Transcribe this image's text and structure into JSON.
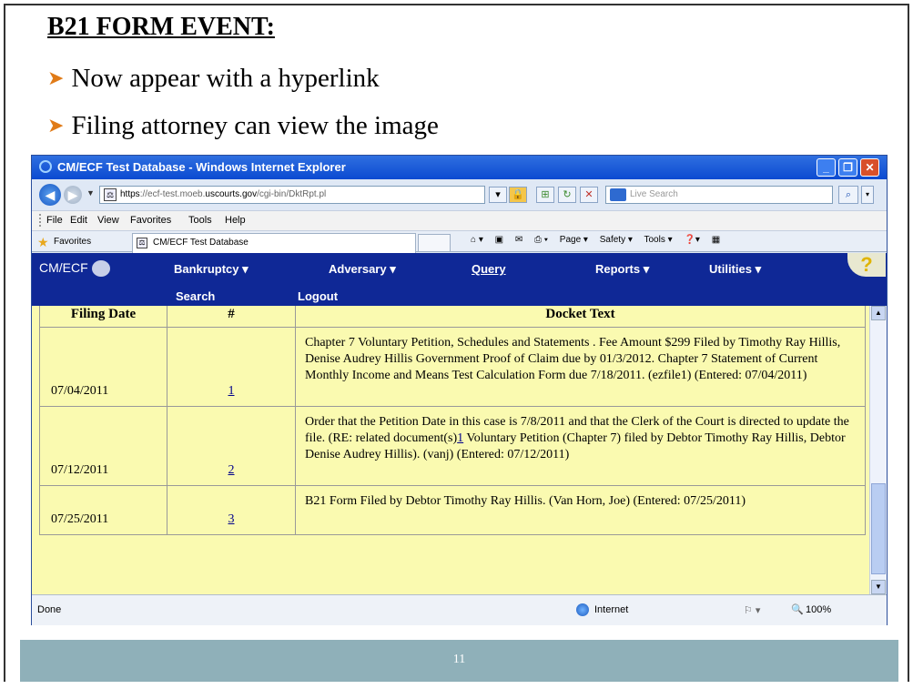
{
  "slide": {
    "title": "B21 FORM EVENT:",
    "bullets": [
      "Now appear with a hyperlink",
      "Filing attorney can view the image"
    ],
    "page_number": "11"
  },
  "browser": {
    "window_title": "CM/ECF Test Database - Windows Internet Explorer",
    "address": {
      "scheme": "https",
      "pre_host": "://ecf-test.moeb.",
      "host": "uscourts.gov",
      "path": "/cgi-bin/DktRpt.pl"
    },
    "search_placeholder": "Live Search",
    "menu": [
      "File",
      "Edit",
      "View",
      "Favorites",
      "Tools",
      "Help"
    ],
    "favorites_label": "Favorites",
    "tab_label": "CM/ECF Test Database",
    "command_bar": [
      "Page ▾",
      "Safety ▾",
      "Tools ▾"
    ],
    "status_text": "Done",
    "zone": "Internet",
    "zoom": "100%"
  },
  "ecf": {
    "logo_text": "CM/ECF",
    "nav": [
      "Bankruptcy ▾",
      "Adversary ▾",
      "Query",
      "Reports ▾",
      "Utilities ▾"
    ],
    "nav_row2": [
      "Search",
      "Logout"
    ],
    "help": "?"
  },
  "docket": {
    "headers": [
      "Filing Date",
      "#",
      "Docket Text"
    ],
    "rows": [
      {
        "date": "07/04/2011",
        "num": "1",
        "text": "Chapter 7 Voluntary Petition, Schedules and Statements . Fee Amount $299 Filed by Timothy Ray Hillis, Denise Audrey Hillis Government Proof of Claim due by 01/3/2012. Chapter 7 Statement of Current Monthly Income and Means Test Calculation Form due 7/18/2011. (ezfile1) (Entered: 07/04/2011)"
      },
      {
        "date": "07/12/2011",
        "num": "2",
        "text_pre": "Order that the Petition Date in this case is 7/8/2011 and that the Clerk of the Court is directed to update the file. (RE: related document(s)",
        "text_link": "1",
        "text_post": " Voluntary Petition (Chapter 7) filed by Debtor Timothy Ray Hillis, Debtor Denise Audrey Hillis). (vanj) (Entered: 07/12/2011)"
      },
      {
        "date": "07/25/2011",
        "num": "3",
        "text": "B21 Form Filed by Debtor Timothy Ray Hillis. (Van Horn, Joe) (Entered: 07/25/2011)"
      }
    ]
  },
  "colors": {
    "ecf_nav": "#0f2896",
    "docket_bg": "#fafab0",
    "footer_bar": "#8fb0b9",
    "bullet_arrow": "#e07b18"
  }
}
